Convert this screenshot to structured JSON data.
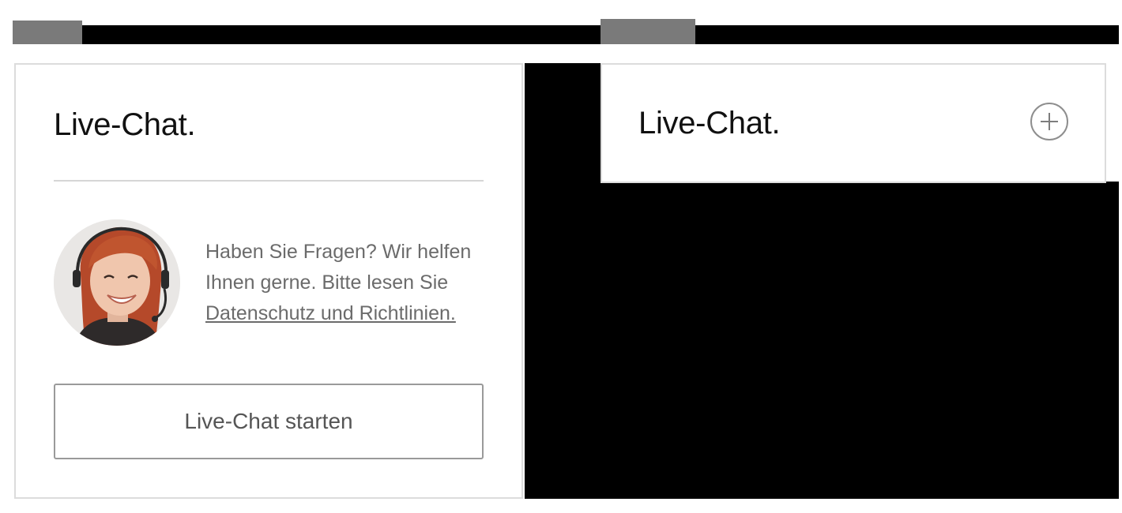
{
  "left_panel": {
    "label_chip": "",
    "card": {
      "title": "Live-Chat.",
      "description": "Haben Sie Fragen? Wir helfen Ihnen gerne. Bitte lesen Sie",
      "privacy_link": "Datenschutz und Richtlinien.",
      "start_button_label": "Live-Chat starten",
      "avatar_icon": "agent-headset-photo"
    }
  },
  "right_panel": {
    "label_chip": "",
    "card": {
      "title": "Live-Chat.",
      "expand_icon": "plus-circle-icon"
    }
  },
  "colors": {
    "bar": "#000000",
    "chip": "#7a7a7a",
    "card_border": "#dcdcdc",
    "text_muted": "#6b6b6b"
  }
}
